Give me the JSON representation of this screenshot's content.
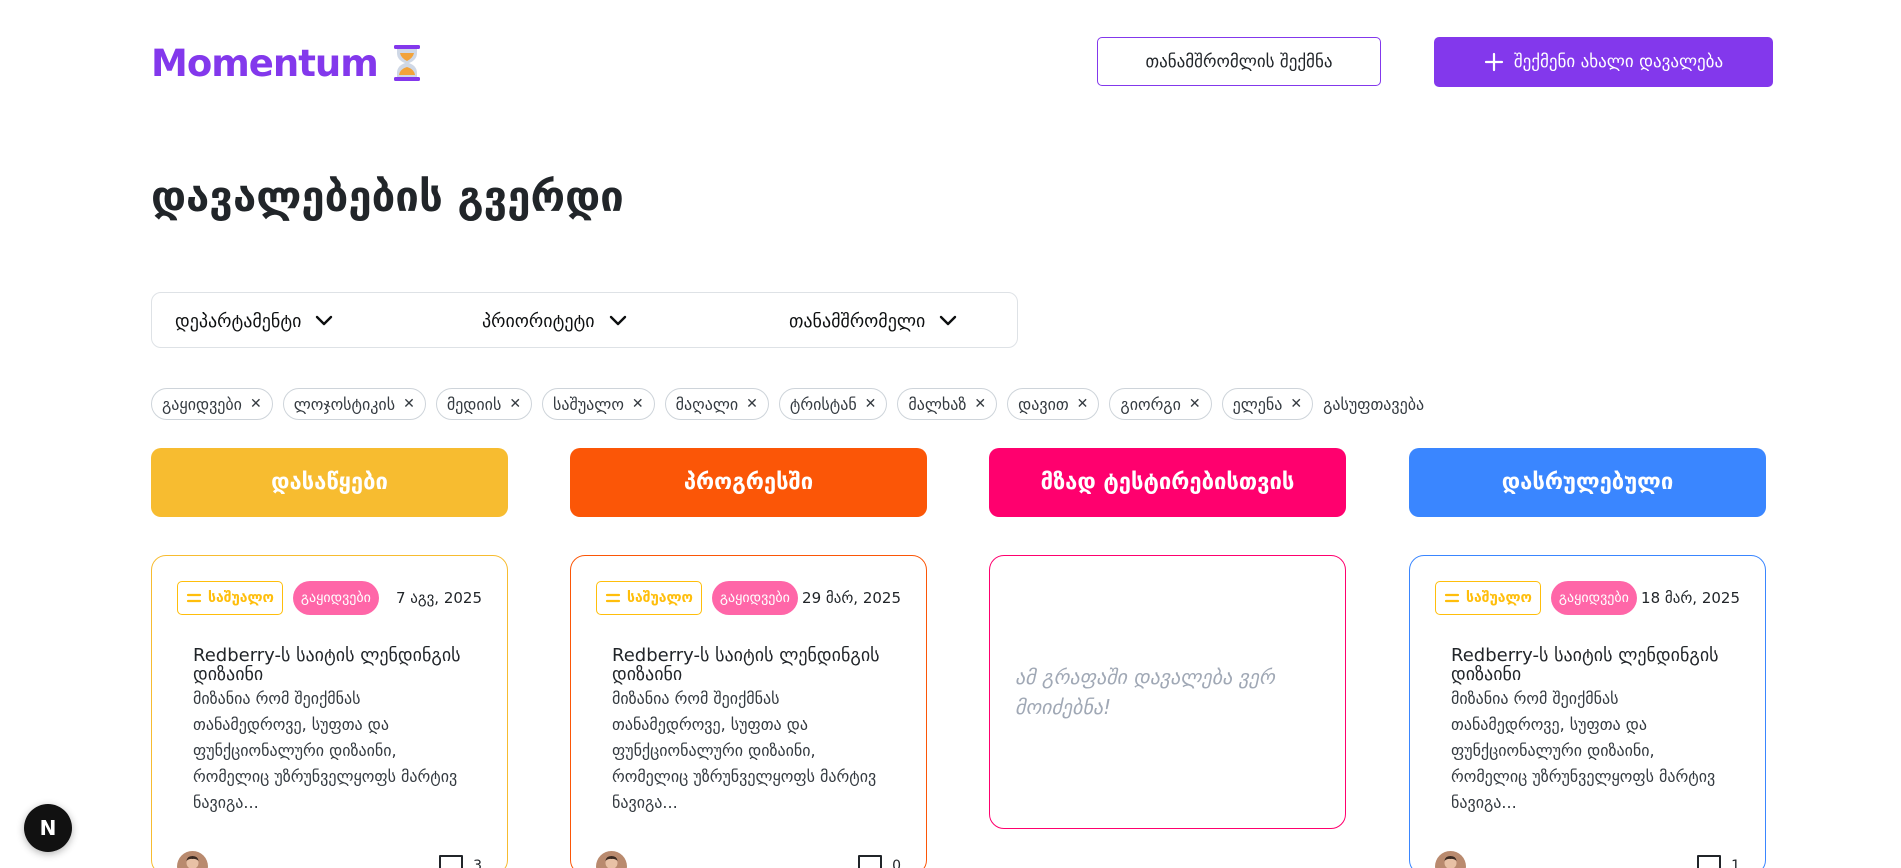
{
  "header": {
    "logo_text": "Momentum",
    "logo_icon": "hourglass-icon",
    "create_employee_label": "თანამშრომლის შექმნა",
    "create_task_label": "შექმენი ახალი დავალება"
  },
  "page_title": "დავალებების გვერდი",
  "filters": [
    {
      "label": "დეპარტამენტი"
    },
    {
      "label": "პრიორიტეტი"
    },
    {
      "label": "თანამშრომელი"
    }
  ],
  "chips": [
    "გაყიდვები",
    "ლოჯოსტიკის",
    "მედიის",
    "საშუალო",
    "მაღალი",
    "ტრისტან",
    "მალხაზ",
    "დავით",
    "გიორგი",
    "ელენა"
  ],
  "clear_all": "გასუფთავება",
  "columns": [
    {
      "title": "დასაწყები",
      "color": "#f7bc30"
    },
    {
      "title": "პროგრესში",
      "color": "#fb5607"
    },
    {
      "title": "მზად ტესტირებისთვის",
      "color": "#ff006e"
    },
    {
      "title": "დასრულებული",
      "color": "#3a86ff"
    }
  ],
  "cards": [
    {
      "priority": "საშუალო",
      "department": "გაყიდვები",
      "date": "7 აგვ, 2025",
      "title": "Redberry-ს საიტის ლენდინგის დიზაინი",
      "description": "მიზანია რომ შეიქმნას თანამედროვე, სუფთა და ფუნქციონალური დიზაინი, რომელიც უზრუნველყოფს მარტივ ნავიგა...",
      "comments": "3"
    },
    {
      "priority": "საშუალო",
      "department": "გაყიდვები",
      "date": "29 მარ, 2025",
      "title": "Redberry-ს საიტის ლენდინგის დიზაინი",
      "description": "მიზანია რომ შეიქმნას თანამედროვე, სუფთა და ფუნქციონალური დიზაინი, რომელიც უზრუნველყოფს მარტივ ნავიგა...",
      "comments": "0"
    },
    {
      "priority": "საშუალო",
      "department": "გაყიდვები",
      "date": "18 მარ, 2025",
      "title": "Redberry-ს საიტის ლენდინგის დიზაინი",
      "description": "მიზანია რომ შეიქმნას თანამედროვე, სუფთა და ფუნქციონალური დიზაინი, რომელიც უზრუნველყოფს მარტივ ნავიგა...",
      "comments": "1"
    }
  ],
  "empty_message": "ამ გრაფაში დავალება ვერ მოიძებნა!",
  "next_badge": "N",
  "colors": {
    "accent": "#8338ec",
    "priority_medium": "#ffbe0b",
    "department_badge": "#ff66a8"
  }
}
